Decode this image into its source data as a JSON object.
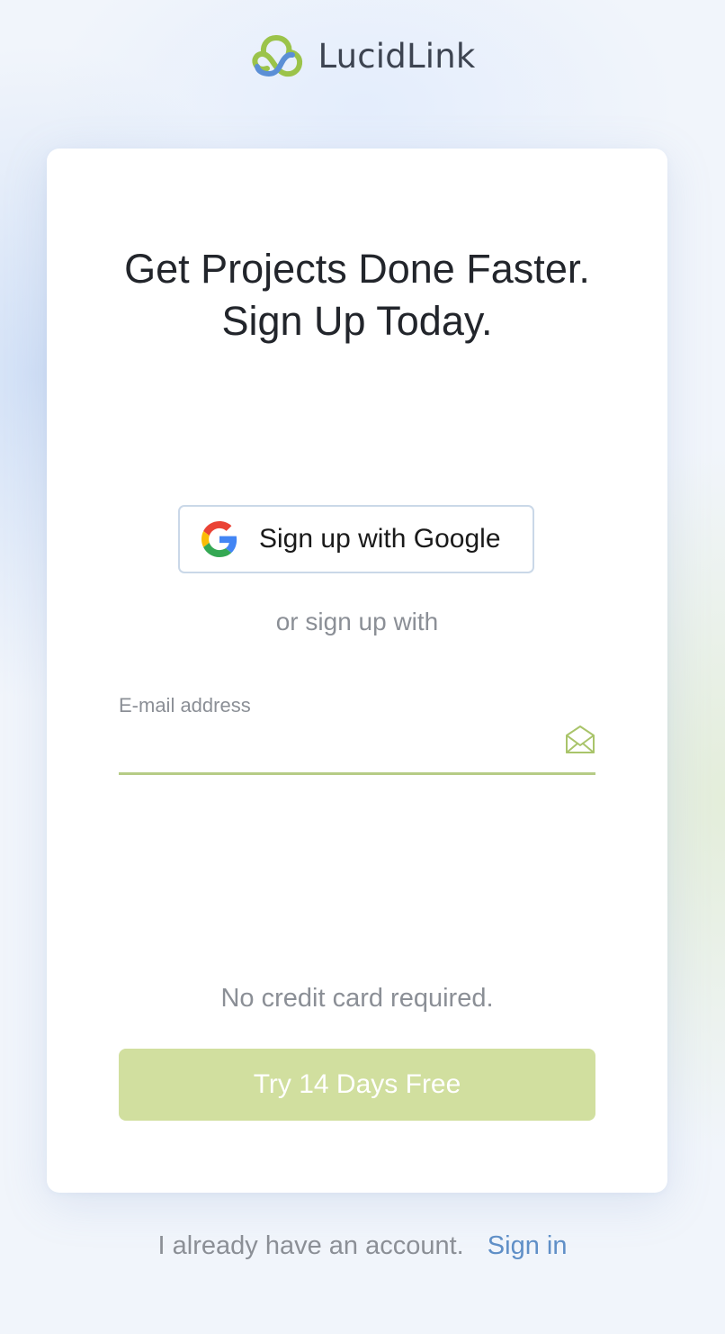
{
  "brand": {
    "name": "LucidLink",
    "icon": "lucidlink-logo-icon",
    "colors": {
      "green": "#9bc34a",
      "blue": "#5b8fd6",
      "text": "#3d4451"
    }
  },
  "card": {
    "headline_line1": "Get Projects Done Faster.",
    "headline_line2": "Sign Up Today.",
    "google_button": {
      "label": "Sign up with Google",
      "icon": "google-g-icon"
    },
    "divider_text": "or sign up with",
    "email": {
      "label": "E-mail address",
      "value": "",
      "placeholder": "",
      "icon": "envelope-icon"
    },
    "no_credit_card": "No credit card required.",
    "submit_button": {
      "label": "Try 14 Days Free",
      "color": "#d1df9f",
      "state": "disabled"
    }
  },
  "footer": {
    "text": "I already have an account.",
    "link_label": "Sign in",
    "link_color": "#5f8fc7"
  }
}
